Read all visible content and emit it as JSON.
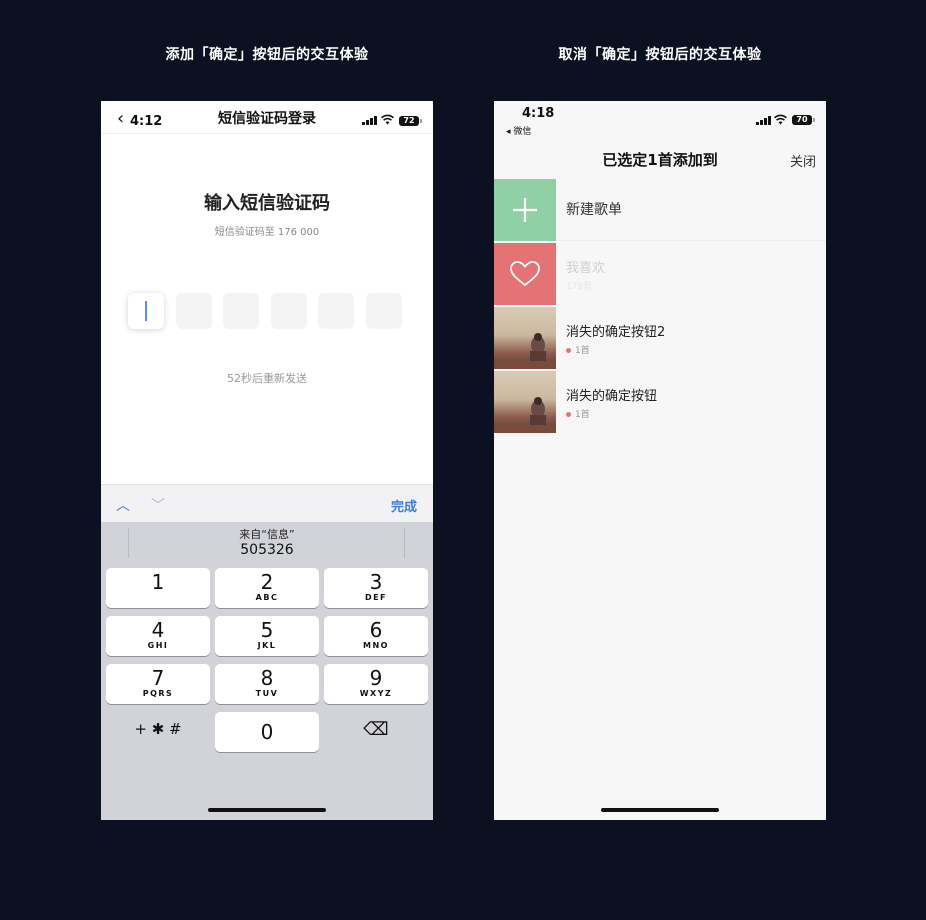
{
  "captions": {
    "left": "添加「确定」按钮后的交互体验",
    "right": "取消「确定」按钮后的交互体验"
  },
  "left_screen": {
    "status": {
      "back_glyph": "‹",
      "time": "4:12",
      "battery": "72"
    },
    "nav_title": "短信验证码登录",
    "heading": "输入短信验证码",
    "subheading": "短信验证码至   176 000",
    "code_boxes": [
      "",
      "",
      "",
      "",
      "",
      ""
    ],
    "resend_text": "52秒后重新发送",
    "keyboard": {
      "up_arrow": "︿",
      "down_arrow": "﹀",
      "done": "完成",
      "suggestion_from": "来自“信息”",
      "suggestion_code": "505326",
      "keys": [
        {
          "num": "1",
          "letters": ""
        },
        {
          "num": "2",
          "letters": "ABC"
        },
        {
          "num": "3",
          "letters": "DEF"
        },
        {
          "num": "4",
          "letters": "GHI"
        },
        {
          "num": "5",
          "letters": "JKL"
        },
        {
          "num": "6",
          "letters": "MNO"
        },
        {
          "num": "7",
          "letters": "PQRS"
        },
        {
          "num": "8",
          "letters": "TUV"
        },
        {
          "num": "9",
          "letters": "WXYZ"
        }
      ],
      "symbols_key": "+ ✱ #",
      "zero_key": "0",
      "delete_key": "⌫"
    }
  },
  "right_screen": {
    "status": {
      "time": "4:18",
      "back_app": "◂ 微信",
      "battery": "70"
    },
    "title": "已选定1首添加到",
    "close": "关闭",
    "new_playlist": "新建歌单",
    "playlists": [
      {
        "name": "我喜欢",
        "count": "179首",
        "style": "heart",
        "faded": true
      },
      {
        "name": "消失的确定按钮2",
        "count": "1首",
        "style": "art",
        "faded": false
      },
      {
        "name": "消失的确定按钮",
        "count": "1首",
        "style": "art",
        "faded": false
      }
    ]
  },
  "colors": {
    "background": "#0b1120",
    "accent_blue": "#3b7de0",
    "new_playlist_green": "#8fd1a4",
    "favorite_red": "#e57373"
  },
  "icons": [
    "signal-icon",
    "wifi-icon",
    "battery-icon",
    "plus-icon",
    "heart-icon",
    "delete-key-icon",
    "chevron-up-icon",
    "chevron-down-icon"
  ]
}
